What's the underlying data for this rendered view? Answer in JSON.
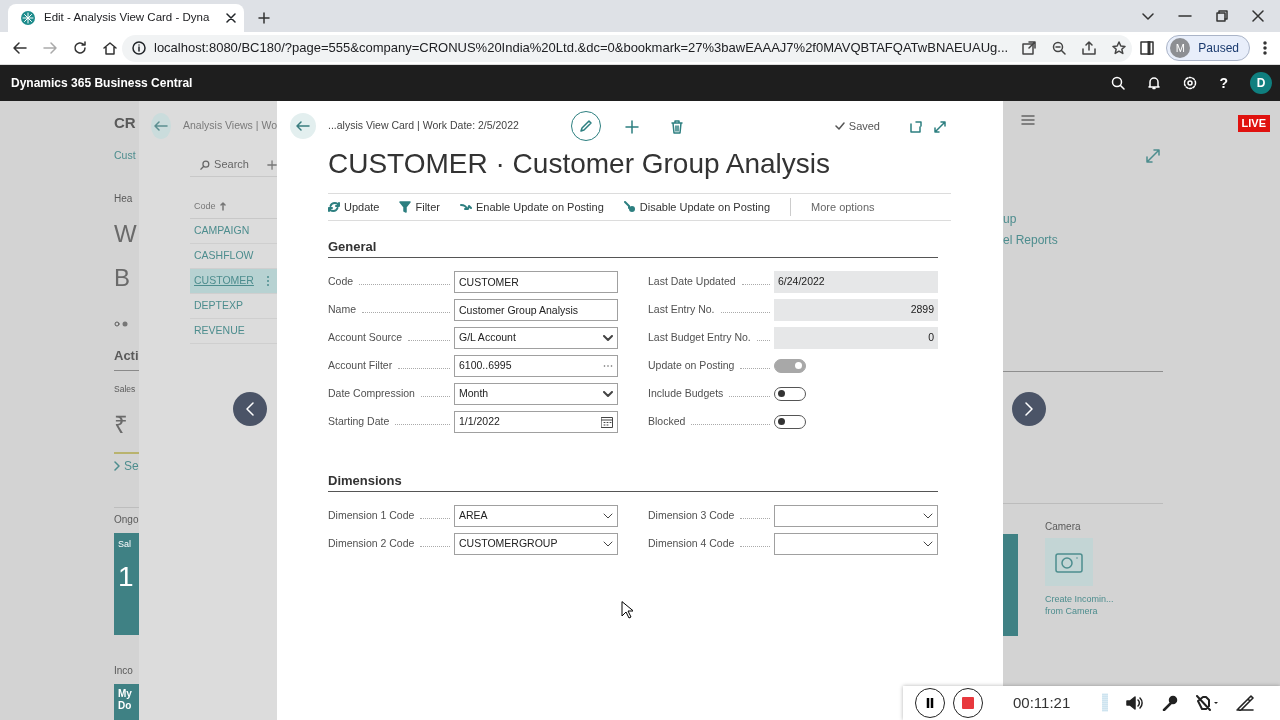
{
  "browser": {
    "tab_title": "Edit - Analysis View Card - Dyna",
    "url": "localhost:8080/BC180/?page=555&company=CRONUS%20India%20Ltd.&dc=0&bookmark=27%3bawEAAAJ7%2f0MAVQBTAFQATwBNAEUAUg...",
    "profile_initial": "M",
    "profile_status": "Paused"
  },
  "app_bar": {
    "title": "Dynamics 365 Business Central",
    "help": "?",
    "avatar": "D"
  },
  "home_page": {
    "company": "CR",
    "link": "Cust",
    "headline_label": "Hea",
    "headline_lines": [
      "W",
      "B"
    ],
    "activities_title": "Acti",
    "sales_label": "Sales",
    "amount": "₹",
    "see_more": "Se",
    "ongoing_title": "Ongo",
    "ongoing_tile": {
      "label": "Sal",
      "value": "1"
    },
    "incoming_title": "Inco",
    "incoming_tile": [
      "My",
      "Do"
    ],
    "links": [
      "up",
      "el Reports"
    ],
    "live_badge": "LIVE",
    "camera": {
      "title": "Camera",
      "caption": [
        "Create Incomin...",
        "from Camera"
      ]
    }
  },
  "list_page": {
    "breadcrumb": "Analysis Views | Wo",
    "search": "Search",
    "column": "Code",
    "rows": [
      {
        "code": "CAMPAIGN",
        "selected": false
      },
      {
        "code": "CASHFLOW",
        "selected": false
      },
      {
        "code": "CUSTOMER",
        "selected": true
      },
      {
        "code": "DEPTEXP",
        "selected": false
      },
      {
        "code": "REVENUE",
        "selected": false
      }
    ]
  },
  "card": {
    "breadcrumb": "...alysis View Card | Work Date: 2/5/2022",
    "saved": "Saved",
    "title": "CUSTOMER · Customer Group Analysis",
    "actions": [
      {
        "label": "Update"
      },
      {
        "label": "Filter"
      },
      {
        "label": "Enable Update on Posting"
      },
      {
        "label": "Disable Update on Posting"
      }
    ],
    "more_options": "More options",
    "sections": [
      {
        "title": "General",
        "left": [
          {
            "label": "Code",
            "kind": "text",
            "value": "CUSTOMER"
          },
          {
            "label": "Name",
            "kind": "text",
            "value": "Customer Group Analysis"
          },
          {
            "label": "Account Source",
            "kind": "select",
            "value": "G/L Account"
          },
          {
            "label": "Account Filter",
            "kind": "lookup",
            "value": "6100..6995"
          },
          {
            "label": "Date Compression",
            "kind": "select",
            "value": "Month"
          },
          {
            "label": "Starting Date",
            "kind": "date",
            "value": "1/1/2022"
          }
        ],
        "right": [
          {
            "label": "Last Date Updated",
            "kind": "readonly",
            "value": "6/24/2022"
          },
          {
            "label": "Last Entry No.",
            "kind": "number",
            "value": "2899"
          },
          {
            "label": "Last Budget Entry No.",
            "kind": "number",
            "value": "0"
          },
          {
            "label": "Update on Posting",
            "kind": "toggle",
            "on": true,
            "disabled": true
          },
          {
            "label": "Include Budgets",
            "kind": "toggle",
            "on": false,
            "disabled": false
          },
          {
            "label": "Blocked",
            "kind": "toggle",
            "on": false,
            "disabled": false
          }
        ]
      },
      {
        "title": "Dimensions",
        "left": [
          {
            "label": "Dimension 1 Code",
            "kind": "combo",
            "value": "AREA"
          },
          {
            "label": "Dimension 2 Code",
            "kind": "combo",
            "value": "CUSTOMERGROUP"
          }
        ],
        "right": [
          {
            "label": "Dimension 3 Code",
            "kind": "combo"
          },
          {
            "label": "Dimension 4 Code",
            "kind": "combo"
          }
        ]
      }
    ]
  },
  "recorder": {
    "time": "00:11:21"
  }
}
